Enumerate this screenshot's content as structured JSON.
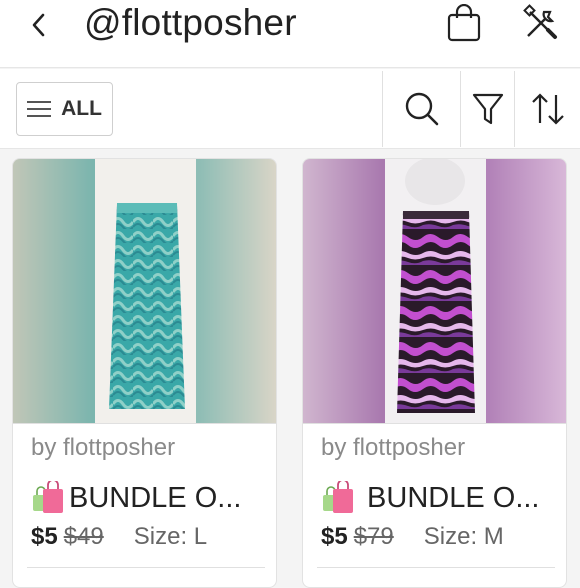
{
  "header": {
    "title": "@flottposher",
    "back_icon": "chevron-left-icon",
    "bag_icon": "shopping-bag-icon",
    "tools_icon": "wrench-screwdriver-icon"
  },
  "toolbar": {
    "all_label": "ALL",
    "icons": [
      "search-icon",
      "filter-icon",
      "sort-icon"
    ]
  },
  "listings": [
    {
      "by": "by flottposher",
      "title": "BUNDLE O...",
      "price": "$5",
      "original_price": "$49",
      "size": "Size: L",
      "accent": "#3aa8a8"
    },
    {
      "by": "by flottposher",
      "title": " BUNDLE O...",
      "price": "$5",
      "original_price": "$79",
      "size": "Size: M",
      "accent": "#b04cc8"
    }
  ]
}
